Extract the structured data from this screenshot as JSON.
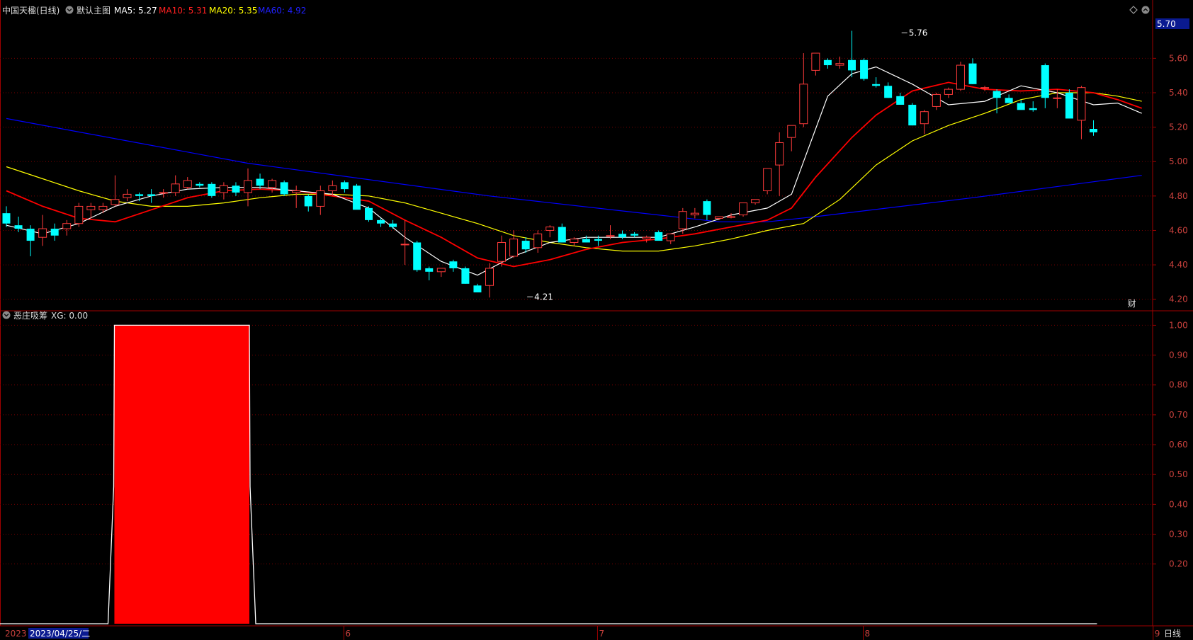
{
  "header": {
    "stock_name": "中国天楹(日线)",
    "main_chart_label": "默认主图",
    "ma5_label": "MA5: 5.27",
    "ma10_label": "MA10: 5.31",
    "ma20_label": "MA20: 5.35",
    "ma60_label": "MA60: 4.92"
  },
  "sub_panel": {
    "title": "恶庄吸筹",
    "xg_label": "XG: 0.00"
  },
  "bottom_bar": {
    "year_label": "2023",
    "cursor_date": "2023/04/25/二",
    "period_button": "日线"
  },
  "colors": {
    "up_candle": "#ff3b3b",
    "down_candle": "#00ffff",
    "ma5": "#ffffff",
    "ma10": "#ff0000",
    "ma20": "#ffff00",
    "ma60": "#0000ff",
    "grid": "#7a0000",
    "axis_text": "#c8403c",
    "signal_bar": "#ff0000"
  },
  "chart_data": [
    {
      "type": "candlestick",
      "yticks": [
        "5.60",
        "5.40",
        "5.20",
        "5.00",
        "4.80",
        "4.60",
        "4.40",
        "4.20"
      ],
      "ylim": [
        4.17,
        5.84
      ],
      "current_price_label": "5.70",
      "month_labels": [
        {
          "label": "6",
          "index": 28
        },
        {
          "label": "7",
          "index": 49
        },
        {
          "label": "8",
          "index": 71
        },
        {
          "label": "9",
          "index": 95
        }
      ],
      "annotations": [
        {
          "text": "5.76",
          "index": 74,
          "value": 5.76
        },
        {
          "text": "4.21",
          "index": 43,
          "value": 4.21
        }
      ],
      "financial_marker": {
        "text": "财",
        "index": 93
      },
      "ohlc": [
        [
          4.7,
          4.74,
          4.62,
          4.64
        ],
        [
          4.63,
          4.68,
          4.59,
          4.61
        ],
        [
          4.61,
          4.63,
          4.45,
          4.54
        ],
        [
          4.56,
          4.69,
          4.51,
          4.61
        ],
        [
          4.61,
          4.64,
          4.54,
          4.57
        ],
        [
          4.61,
          4.66,
          4.57,
          4.64
        ],
        [
          4.64,
          4.76,
          4.62,
          4.74
        ],
        [
          4.72,
          4.76,
          4.67,
          4.74
        ],
        [
          4.72,
          4.76,
          4.7,
          4.74
        ],
        [
          4.75,
          4.92,
          4.74,
          4.78
        ],
        [
          4.79,
          4.84,
          4.77,
          4.81
        ],
        [
          4.81,
          4.82,
          4.77,
          4.8
        ],
        [
          4.81,
          4.84,
          4.76,
          4.8
        ],
        [
          4.82,
          4.84,
          4.79,
          4.82
        ],
        [
          4.82,
          4.92,
          4.8,
          4.87
        ],
        [
          4.85,
          4.91,
          4.84,
          4.89
        ],
        [
          4.87,
          4.88,
          4.85,
          4.86
        ],
        [
          4.87,
          4.88,
          4.79,
          4.8
        ],
        [
          4.82,
          4.88,
          4.78,
          4.86
        ],
        [
          4.86,
          4.88,
          4.8,
          4.82
        ],
        [
          4.82,
          4.96,
          4.74,
          4.89
        ],
        [
          4.9,
          4.93,
          4.84,
          4.86
        ],
        [
          4.85,
          4.9,
          4.82,
          4.89
        ],
        [
          4.88,
          4.89,
          4.8,
          4.81
        ],
        [
          4.82,
          4.86,
          4.73,
          4.83
        ],
        [
          4.8,
          4.81,
          4.71,
          4.74
        ],
        [
          4.74,
          4.86,
          4.69,
          4.83
        ],
        [
          4.83,
          4.89,
          4.8,
          4.86
        ],
        [
          4.88,
          4.89,
          4.82,
          4.84
        ],
        [
          4.86,
          4.87,
          4.74,
          4.72
        ],
        [
          4.73,
          4.74,
          4.65,
          4.66
        ],
        [
          4.66,
          4.67,
          4.62,
          4.64
        ],
        [
          4.64,
          4.66,
          4.61,
          4.62
        ],
        [
          4.52,
          4.66,
          4.4,
          4.52
        ],
        [
          4.53,
          4.54,
          4.36,
          4.37
        ],
        [
          4.38,
          4.39,
          4.31,
          4.36
        ],
        [
          4.36,
          4.38,
          4.33,
          4.38
        ],
        [
          4.42,
          4.43,
          4.36,
          4.38
        ],
        [
          4.38,
          4.39,
          4.29,
          4.29
        ],
        [
          4.28,
          4.29,
          4.24,
          4.24
        ],
        [
          4.28,
          4.41,
          4.21,
          4.38
        ],
        [
          4.42,
          4.57,
          4.39,
          4.53
        ],
        [
          4.45,
          4.6,
          4.44,
          4.55
        ],
        [
          4.54,
          4.56,
          4.47,
          4.49
        ],
        [
          4.5,
          4.6,
          4.47,
          4.58
        ],
        [
          4.6,
          4.63,
          4.56,
          4.62
        ],
        [
          4.62,
          4.64,
          4.53,
          4.53
        ],
        [
          4.53,
          4.56,
          4.51,
          4.55
        ],
        [
          4.55,
          4.57,
          4.53,
          4.53
        ],
        [
          4.55,
          4.57,
          4.51,
          4.54
        ],
        [
          4.57,
          4.63,
          4.55,
          4.57
        ],
        [
          4.58,
          4.6,
          4.55,
          4.56
        ],
        [
          4.58,
          4.59,
          4.56,
          4.57
        ],
        [
          4.55,
          4.57,
          4.53,
          4.56
        ],
        [
          4.59,
          4.6,
          4.55,
          4.54
        ],
        [
          4.54,
          4.57,
          4.52,
          4.58
        ],
        [
          4.61,
          4.73,
          4.58,
          4.71
        ],
        [
          4.69,
          4.73,
          4.67,
          4.7
        ],
        [
          4.77,
          4.78,
          4.66,
          4.69
        ],
        [
          4.67,
          4.68,
          4.66,
          4.68
        ],
        [
          4.68,
          4.7,
          4.67,
          4.68
        ],
        [
          4.69,
          4.76,
          4.68,
          4.76
        ],
        [
          4.76,
          4.78,
          4.75,
          4.78
        ],
        [
          4.83,
          4.96,
          4.81,
          4.96
        ],
        [
          4.98,
          5.17,
          4.8,
          5.11
        ],
        [
          5.14,
          5.21,
          5.06,
          5.21
        ],
        [
          5.22,
          5.63,
          5.2,
          5.45
        ],
        [
          5.53,
          5.63,
          5.5,
          5.63
        ],
        [
          5.59,
          5.6,
          5.54,
          5.56
        ],
        [
          5.56,
          5.61,
          5.54,
          5.57
        ],
        [
          5.59,
          5.76,
          5.49,
          5.53
        ],
        [
          5.59,
          5.6,
          5.47,
          5.48
        ],
        [
          5.45,
          5.49,
          5.43,
          5.44
        ],
        [
          5.44,
          5.46,
          5.37,
          5.37
        ],
        [
          5.38,
          5.4,
          5.33,
          5.33
        ],
        [
          5.33,
          5.34,
          5.21,
          5.21
        ],
        [
          5.22,
          5.3,
          5.16,
          5.29
        ],
        [
          5.32,
          5.4,
          5.3,
          5.39
        ],
        [
          5.39,
          5.43,
          5.37,
          5.42
        ],
        [
          5.42,
          5.58,
          5.41,
          5.56
        ],
        [
          5.57,
          5.6,
          5.45,
          5.45
        ],
        [
          5.43,
          5.44,
          5.41,
          5.43
        ],
        [
          5.41,
          5.42,
          5.28,
          5.37
        ],
        [
          5.37,
          5.39,
          5.34,
          5.34
        ],
        [
          5.34,
          5.36,
          5.32,
          5.3
        ],
        [
          5.31,
          5.35,
          5.29,
          5.3
        ],
        [
          5.56,
          5.57,
          5.31,
          5.37
        ],
        [
          5.37,
          5.42,
          5.31,
          5.37
        ],
        [
          5.4,
          5.42,
          5.27,
          5.25
        ],
        [
          5.24,
          5.44,
          5.13,
          5.43
        ],
        [
          5.19,
          5.24,
          5.15,
          5.17
        ]
      ],
      "ma5": [
        [
          0,
          4.63
        ],
        [
          3,
          4.58
        ],
        [
          6,
          4.64
        ],
        [
          9,
          4.74
        ],
        [
          12,
          4.8
        ],
        [
          15,
          4.84
        ],
        [
          18,
          4.85
        ],
        [
          21,
          4.85
        ],
        [
          24,
          4.83
        ],
        [
          27,
          4.81
        ],
        [
          30,
          4.73
        ],
        [
          33,
          4.56
        ],
        [
          36,
          4.42
        ],
        [
          39,
          4.34
        ],
        [
          42,
          4.45
        ],
        [
          45,
          4.53
        ],
        [
          48,
          4.56
        ],
        [
          51,
          4.56
        ],
        [
          54,
          4.56
        ],
        [
          57,
          4.62
        ],
        [
          60,
          4.69
        ],
        [
          63,
          4.73
        ],
        [
          65,
          4.81
        ],
        [
          66,
          5.0
        ],
        [
          68,
          5.38
        ],
        [
          70,
          5.51
        ],
        [
          72,
          5.55
        ],
        [
          75,
          5.45
        ],
        [
          78,
          5.33
        ],
        [
          81,
          5.35
        ],
        [
          84,
          5.44
        ],
        [
          87,
          5.4
        ],
        [
          90,
          5.33
        ],
        [
          92,
          5.34
        ],
        [
          94,
          5.28
        ]
      ],
      "ma10": [
        [
          0,
          4.83
        ],
        [
          3,
          4.74
        ],
        [
          6,
          4.67
        ],
        [
          9,
          4.65
        ],
        [
          12,
          4.72
        ],
        [
          15,
          4.79
        ],
        [
          18,
          4.83
        ],
        [
          21,
          4.84
        ],
        [
          24,
          4.83
        ],
        [
          27,
          4.8
        ],
        [
          30,
          4.77
        ],
        [
          33,
          4.66
        ],
        [
          36,
          4.56
        ],
        [
          39,
          4.44
        ],
        [
          42,
          4.39
        ],
        [
          45,
          4.43
        ],
        [
          48,
          4.49
        ],
        [
          51,
          4.53
        ],
        [
          54,
          4.55
        ],
        [
          57,
          4.58
        ],
        [
          60,
          4.62
        ],
        [
          63,
          4.66
        ],
        [
          65,
          4.73
        ],
        [
          67,
          4.91
        ],
        [
          70,
          5.14
        ],
        [
          72,
          5.27
        ],
        [
          75,
          5.41
        ],
        [
          78,
          5.46
        ],
        [
          81,
          5.42
        ],
        [
          84,
          5.41
        ],
        [
          87,
          5.42
        ],
        [
          90,
          5.4
        ],
        [
          92,
          5.36
        ],
        [
          94,
          5.31
        ]
      ],
      "ma20": [
        [
          0,
          4.97
        ],
        [
          3,
          4.9
        ],
        [
          6,
          4.83
        ],
        [
          9,
          4.77
        ],
        [
          12,
          4.74
        ],
        [
          15,
          4.74
        ],
        [
          18,
          4.76
        ],
        [
          21,
          4.79
        ],
        [
          24,
          4.81
        ],
        [
          27,
          4.81
        ],
        [
          30,
          4.8
        ],
        [
          33,
          4.76
        ],
        [
          36,
          4.7
        ],
        [
          39,
          4.64
        ],
        [
          42,
          4.57
        ],
        [
          45,
          4.53
        ],
        [
          48,
          4.5
        ],
        [
          51,
          4.48
        ],
        [
          54,
          4.48
        ],
        [
          57,
          4.51
        ],
        [
          60,
          4.55
        ],
        [
          63,
          4.6
        ],
        [
          66,
          4.64
        ],
        [
          69,
          4.78
        ],
        [
          72,
          4.98
        ],
        [
          75,
          5.12
        ],
        [
          78,
          5.21
        ],
        [
          81,
          5.28
        ],
        [
          84,
          5.36
        ],
        [
          87,
          5.4
        ],
        [
          90,
          5.4
        ],
        [
          92,
          5.38
        ],
        [
          94,
          5.35
        ]
      ],
      "ma60": [
        [
          0,
          5.25
        ],
        [
          20,
          4.99
        ],
        [
          40,
          4.8
        ],
        [
          59,
          4.65
        ],
        [
          63,
          4.65
        ],
        [
          67,
          4.68
        ],
        [
          80,
          4.79
        ],
        [
          94,
          4.92
        ]
      ]
    },
    {
      "type": "bar",
      "title": "恶庄吸筹",
      "yticks": [
        "1.00",
        "0.90",
        "0.80",
        "0.70",
        "0.60",
        "0.50",
        "0.40",
        "0.30",
        "0.20"
      ],
      "ylim": [
        0,
        1.02
      ],
      "signal_value": 1.0,
      "signal_start_index": 9,
      "signal_end_index": 20,
      "baseline_value": 0
    }
  ]
}
